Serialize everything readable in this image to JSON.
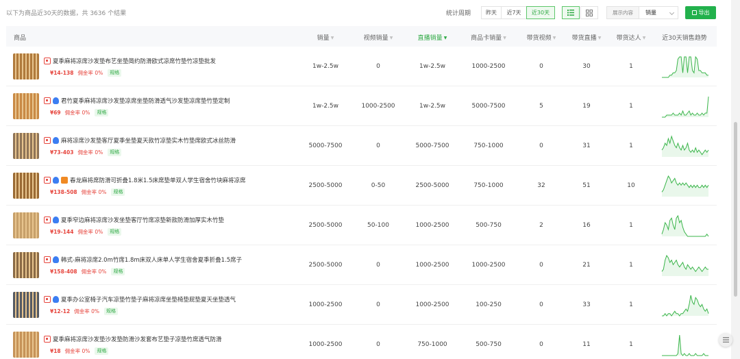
{
  "toolbar": {
    "summary": "以下为商品近30天的数据，共 3636 个结果",
    "period_label": "统计周期",
    "periods": [
      "昨天",
      "近7天",
      "近30天"
    ],
    "active_period": "近30天",
    "display_label": "展示内容",
    "display_value": "销量",
    "export_label": "导出"
  },
  "table": {
    "columns": [
      "商品",
      "销量",
      "视频销量",
      "直播销量",
      "商品卡销量",
      "带货视频",
      "带货直播",
      "带货达人",
      "近30天销售趋势"
    ],
    "sorted_column": "直播销量",
    "rows": [
      {
        "title": "夏季麻将凉席沙发垫布艺坐垫简约防滑欧式凉席竹垫竹凉垫批发",
        "price": "¥14-138",
        "commission": "佣金率 0%",
        "spec": "规格",
        "sales": "1w-2.5w",
        "video_sales": "0",
        "live_sales": "1w-2.5w",
        "card_sales": "1000-2500",
        "videos": "0",
        "lives": "30",
        "influencers": "1",
        "badges": [
          "douyin"
        ],
        "trend": [
          0,
          0,
          0,
          0,
          0,
          1,
          1,
          2,
          2,
          3,
          8,
          9,
          9,
          2,
          9,
          9,
          2,
          9,
          9,
          3,
          2,
          9,
          8,
          3,
          3,
          2,
          2,
          2,
          1,
          1
        ]
      },
      {
        "title": "君竹夏季麻将凉席沙发垫凉席坐垫防滑透气沙发垫凉席垫竹垫定制",
        "price": "¥69",
        "commission": "佣金率 0%",
        "spec": "规格",
        "sales": "1w-2.5w",
        "video_sales": "1000-2500",
        "live_sales": "1w-2.5w",
        "card_sales": "5000-7500",
        "videos": "5",
        "lives": "19",
        "influencers": "1",
        "badges": [
          "douyin",
          "person"
        ],
        "trend": [
          0,
          0,
          0,
          1,
          1,
          1,
          1,
          2,
          1,
          1,
          1,
          2,
          1,
          3,
          1,
          1,
          2,
          3,
          1,
          2,
          1,
          1,
          2,
          1,
          1,
          2,
          1,
          2,
          2,
          10
        ]
      },
      {
        "title": "麻将凉席沙发垫客厅夏季坐垫夏天款竹凉垫实木竹垫席欧式冰丝防滑",
        "price": "¥73-403",
        "commission": "佣金率 0%",
        "spec": "规格",
        "sales": "5000-7500",
        "video_sales": "0",
        "live_sales": "5000-7500",
        "card_sales": "750-1000",
        "videos": "0",
        "lives": "31",
        "influencers": "1",
        "badges": [
          "douyin",
          "person"
        ],
        "trend": [
          3,
          4,
          6,
          5,
          8,
          6,
          9,
          7,
          5,
          4,
          6,
          4,
          3,
          5,
          3,
          4,
          6,
          3,
          2,
          3,
          2,
          4,
          2,
          3,
          2,
          1,
          2,
          3,
          2,
          3
        ]
      },
      {
        "title": "春龙麻将席防滑可折叠1.8米1.5床席垫单双人学生宿舍竹块麻将凉席",
        "price": "¥138-508",
        "commission": "佣金率 0%",
        "spec": "规格",
        "sales": "2500-5000",
        "video_sales": "0-50",
        "live_sales": "2500-5000",
        "card_sales": "750-1000",
        "videos": "32",
        "lives": "51",
        "influencers": "10",
        "badges": [
          "douyin",
          "person",
          "shop"
        ],
        "trend": [
          2,
          3,
          5,
          7,
          9,
          8,
          6,
          7,
          8,
          6,
          5,
          6,
          5,
          6,
          5,
          6,
          5,
          4,
          5,
          4,
          5,
          4,
          5,
          4,
          4,
          5,
          4,
          5,
          4,
          5
        ]
      },
      {
        "title": "夏季窄边麻将凉席沙发坐垫客厅竹席凉垫新款防滑加厚实木竹垫",
        "price": "¥19-144",
        "commission": "佣金率 0%",
        "spec": "规格",
        "sales": "2500-5000",
        "video_sales": "50-100",
        "live_sales": "1000-2500",
        "card_sales": "500-750",
        "videos": "2",
        "lives": "16",
        "influencers": "1",
        "badges": [
          "douyin",
          "person"
        ],
        "trend": [
          1,
          3,
          6,
          5,
          3,
          7,
          8,
          5,
          3,
          8,
          9,
          6,
          7,
          4,
          2,
          1,
          0,
          0,
          0,
          0,
          0,
          0,
          0,
          0,
          0,
          0,
          0,
          0,
          1,
          0
        ]
      },
      {
        "title": "韩式-麻将凉席2.0m竹席1.8m床双人床单人学生宿舍夏季折叠1.5席子",
        "price": "¥158-408",
        "commission": "佣金率 0%",
        "spec": "规格",
        "sales": "2500-5000",
        "video_sales": "0",
        "live_sales": "1000-2500",
        "card_sales": "1000-2500",
        "videos": "0",
        "lives": "21",
        "influencers": "1",
        "badges": [
          "douyin",
          "person"
        ],
        "trend": [
          2,
          3,
          7,
          9,
          8,
          6,
          7,
          5,
          6,
          7,
          5,
          4,
          5,
          6,
          4,
          3,
          5,
          4,
          3,
          4,
          3,
          2,
          3,
          4,
          3,
          2,
          3,
          4,
          3,
          3
        ]
      },
      {
        "title": "夏季办公室椅子汽车凉垫竹垫子麻将凉席坐垫椅垫屁垫夏天坐垫透气",
        "price": "¥12-12",
        "commission": "佣金率 0%",
        "spec": "规格",
        "sales": "1000-2500",
        "video_sales": "0",
        "live_sales": "1000-2500",
        "card_sales": "100-250",
        "videos": "0",
        "lives": "33",
        "influencers": "1",
        "badges": [
          "douyin",
          "person"
        ],
        "trend": [
          0,
          0,
          1,
          0,
          1,
          1,
          0,
          1,
          2,
          1,
          1,
          0,
          1,
          1,
          2,
          3,
          2,
          5,
          9,
          6,
          5,
          8,
          7,
          5,
          4,
          5,
          3,
          2,
          3,
          1
        ]
      },
      {
        "title": "夏季麻将凉席沙发垫沙发垫防滑沙发套布艺垫子凉垫竹席透气防滑",
        "price": "¥18",
        "commission": "佣金率 0%",
        "spec": "规格",
        "sales": "1000-2500",
        "video_sales": "0",
        "live_sales": "750-1000",
        "card_sales": "500-750",
        "videos": "0",
        "lives": "11",
        "influencers": "1",
        "badges": [
          "douyin"
        ],
        "trend": [
          0,
          0,
          0,
          0,
          0,
          0,
          0,
          0,
          0,
          0,
          1,
          10,
          1,
          0,
          1,
          0,
          0,
          1,
          0,
          0,
          0,
          1,
          0,
          0,
          0,
          0,
          1,
          0,
          0,
          0
        ]
      }
    ]
  },
  "colors": {
    "accent": "#2fa944",
    "export": "#22b14c",
    "price": "#e6453d",
    "trend": "#3ab54a"
  },
  "icons": [
    "list-view-icon",
    "grid-view-icon",
    "export-icon",
    "douyin-badge-icon",
    "person-badge-icon",
    "shop-badge-icon",
    "sort-icon"
  ]
}
